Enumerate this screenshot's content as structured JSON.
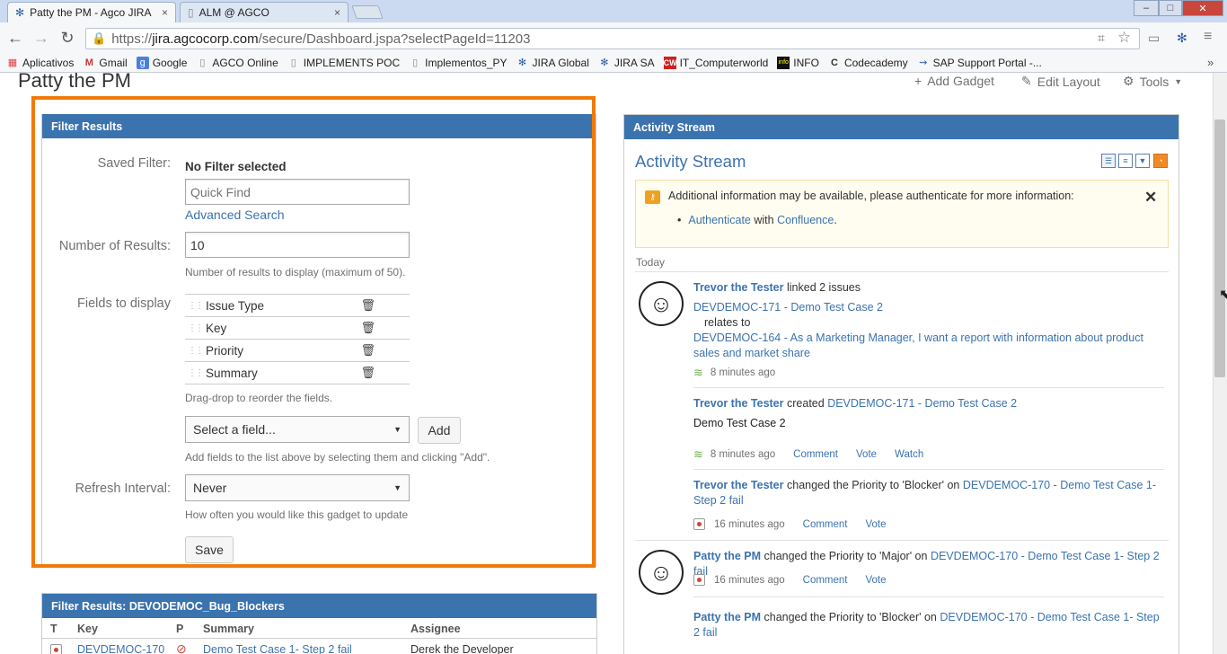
{
  "browser": {
    "tabs": [
      {
        "title": "Patty the PM - Agco JIRA",
        "close": "×"
      },
      {
        "title": "ALM @ AGCO",
        "close": "×"
      }
    ],
    "window_controls": {
      "minimize": "–",
      "maximize": "□",
      "close": "✕"
    },
    "url": {
      "scheme": "https://",
      "host": "jira.agcocorp.com",
      "path": "/secure/Dashboard.jspa?selectPageId=11203"
    },
    "bookmarks": [
      {
        "label": "Aplicativos",
        "icon": "apps-grid-icon"
      },
      {
        "label": "Gmail",
        "icon": "gmail-icon"
      },
      {
        "label": "Google",
        "icon": "google-icon"
      },
      {
        "label": "AGCO Online",
        "icon": "page-icon"
      },
      {
        "label": "IMPLEMENTS POC",
        "icon": "page-icon"
      },
      {
        "label": "Implementos_PY",
        "icon": "page-icon"
      },
      {
        "label": "JIRA Global",
        "icon": "jira-icon"
      },
      {
        "label": "JIRA SA",
        "icon": "jira-icon"
      },
      {
        "label": "IT_Computerworld",
        "icon": "cw-icon"
      },
      {
        "label": "INFO",
        "icon": "info-icon"
      },
      {
        "label": "Codecademy",
        "icon": "codecademy-icon"
      },
      {
        "label": "SAP Support Portal -...",
        "icon": "sap-icon"
      }
    ],
    "bookmarks_more": "»"
  },
  "dashboard": {
    "title": "Patty the PM",
    "actions": {
      "add_gadget": "Add Gadget",
      "edit_layout": "Edit Layout",
      "tools": "Tools"
    }
  },
  "filter_gadget": {
    "header": "Filter Results",
    "saved_filter_label": "Saved Filter:",
    "no_filter": "No Filter selected",
    "quick_find_placeholder": "Quick Find",
    "advanced_search": "Advanced Search",
    "number_label": "Number of Results:",
    "number_value": "10",
    "number_help": "Number of results to display (maximum of 50).",
    "fields_label": "Fields to display",
    "fields": [
      "Issue Type",
      "Key",
      "Priority",
      "Summary"
    ],
    "fields_help": "Drag-drop to reorder the fields.",
    "select_field": "Select a field...",
    "add_button": "Add",
    "add_help": "Add fields to the list above by selecting them and clicking \"Add\".",
    "refresh_label": "Refresh Interval:",
    "refresh_value": "Never",
    "refresh_help": "How often you would like this gadget to update",
    "save_button": "Save"
  },
  "results_gadget": {
    "header": "Filter Results: DEVODEMOC_Bug_Blockers",
    "columns": [
      "T",
      "Key",
      "P",
      "Summary",
      "Assignee"
    ],
    "rows": [
      {
        "key": "DEVDEMOC-170",
        "summary": "Demo Test Case 1- Step 2 fail",
        "assignee": "Derek the Developer"
      }
    ]
  },
  "activity_gadget": {
    "header": "Activity Stream",
    "title": "Activity Stream",
    "info": {
      "message": "Additional information may be available, please authenticate for more information:",
      "auth_link": "Authenticate",
      "with": "with",
      "confluence": "Confluence",
      "period": "."
    },
    "today": "Today",
    "items": [
      {
        "who": "Trevor the Tester",
        "action": "linked 2 issues",
        "issue1": "DEVDEMOC-171 - Demo Test Case 2",
        "relation": "relates to",
        "issue2": "DEVDEMOC-164 - As a Marketing Manager, I want a report with information about product sales and market share",
        "time": "8 minutes ago"
      },
      {
        "who": "Trevor the Tester",
        "action": "created",
        "issue": "DEVDEMOC-171 - Demo Test Case 2",
        "body": "Demo Test Case 2",
        "time": "8 minutes ago",
        "links": [
          "Comment",
          "Vote",
          "Watch"
        ]
      },
      {
        "who": "Trevor the Tester",
        "action": "changed the Priority to 'Blocker' on",
        "issue": "DEVDEMOC-170 - Demo Test Case 1- Step 2 fail",
        "time": "16 minutes ago",
        "links": [
          "Comment",
          "Vote"
        ]
      },
      {
        "who": "Patty the PM",
        "action": "changed the Priority to 'Major' on",
        "issue": "DEVDEMOC-170 - Demo Test Case 1- Step 2 fail",
        "time": "16 minutes ago",
        "links": [
          "Comment",
          "Vote"
        ]
      },
      {
        "who": "Patty the PM",
        "action": "changed the Priority to 'Blocker' on",
        "issue": "DEVDEMOC-170 - Demo Test Case 1- Step 2 fail"
      }
    ]
  },
  "colors": {
    "accent": "#3b73af",
    "highlight": "#f07b0a",
    "blocker": "#d04437"
  }
}
